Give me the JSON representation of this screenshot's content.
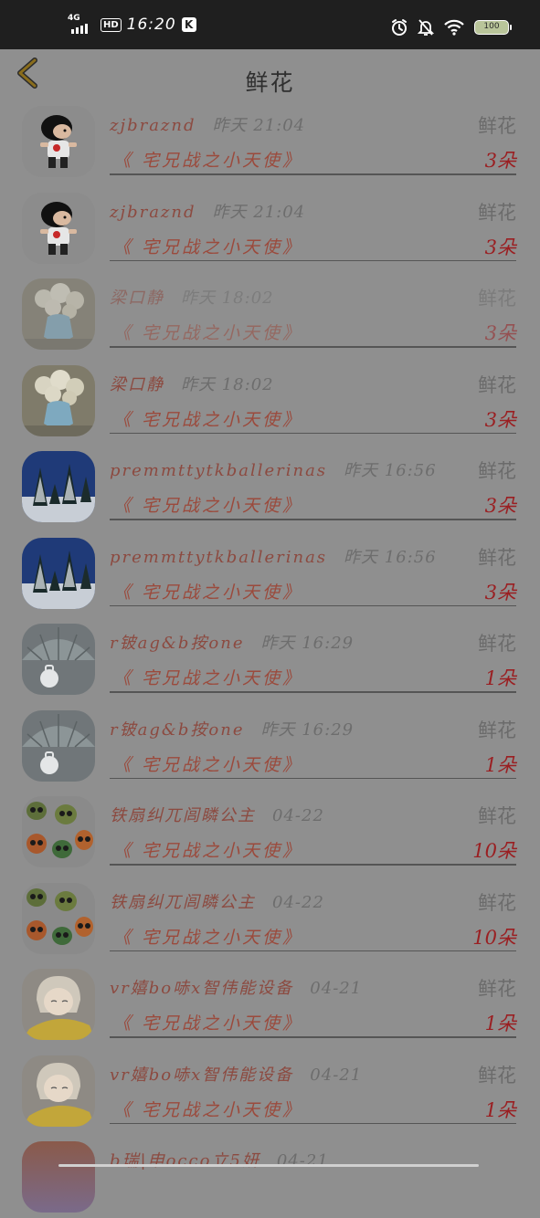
{
  "status_bar": {
    "network": "4G",
    "hd": "HD",
    "time": "16:20",
    "k_badge": "K",
    "battery": "100",
    "icons": [
      "alarm-icon",
      "bell-off-icon",
      "wifi-icon",
      "battery-icon"
    ]
  },
  "header": {
    "title": "鲜花",
    "back_icon": "chevron-left-icon",
    "accent": "#8a6d1c"
  },
  "records": [
    {
      "name": "zjbraznd",
      "time": "昨天 21:04",
      "type": "鲜花",
      "gift": "《 宅兄战之小天使》",
      "count": "3朵",
      "avatar": "cartoon-boy"
    },
    {
      "name": "zjbraznd",
      "time": "昨天 21:04",
      "type": "鲜花",
      "gift": "《 宅兄战之小天使》",
      "count": "3朵",
      "avatar": "cartoon-boy"
    },
    {
      "name": "梁口静",
      "time": "昨天 18:02",
      "type": "鲜花",
      "gift": "《 宅兄战之小天使》",
      "count": "3朵",
      "avatar": "flower-vase",
      "dim": true
    },
    {
      "name": "梁口静",
      "time": "昨天 18:02",
      "type": "鲜花",
      "gift": "《 宅兄战之小天使》",
      "count": "3朵",
      "avatar": "flower-vase"
    },
    {
      "name": "premmttytkballerinas",
      "time": "昨天 16:56",
      "type": "鲜花",
      "gift": "《 宅兄战之小天使》",
      "count": "3朵",
      "avatar": "snowy-forest"
    },
    {
      "name": "premmttytkballerinas",
      "time": "昨天 16:56",
      "type": "鲜花",
      "gift": "《 宅兄战之小天使》",
      "count": "3朵",
      "avatar": "snowy-forest"
    },
    {
      "name": "r铍ag&b按one",
      "time": "昨天 16:29",
      "type": "鲜花",
      "gift": "《 宅兄战之小天使》",
      "count": "1朵",
      "avatar": "umbrella"
    },
    {
      "name": "r铍ag&b按one",
      "time": "昨天 16:29",
      "type": "鲜花",
      "gift": "《 宅兄战之小天使》",
      "count": "1朵",
      "avatar": "umbrella"
    },
    {
      "name": "铁扇纠兀闾瞵公主",
      "time": "04-22",
      "type": "鲜花",
      "gift": "《 宅兄战之小天使》",
      "count": "10朵",
      "avatar": "skulls"
    },
    {
      "name": "铁扇纠兀闾瞵公主",
      "time": "04-22",
      "type": "鲜花",
      "gift": "《 宅兄战之小天使》",
      "count": "10朵",
      "avatar": "skulls"
    },
    {
      "name": "vr嬉bo哧x智伟能设备",
      "time": "04-21",
      "type": "鲜花",
      "gift": "《 宅兄战之小天使》",
      "count": "1朵",
      "avatar": "anime-boy"
    },
    {
      "name": "vr嬉bo哧x智伟能设备",
      "time": "04-21",
      "type": "鲜花",
      "gift": "《 宅兄战之小天使》",
      "count": "1朵",
      "avatar": "anime-boy"
    },
    {
      "name": "b瑞|申occo立5妍",
      "time": "04-21",
      "type": "",
      "gift": "",
      "count": "",
      "avatar": "sunset"
    }
  ]
}
